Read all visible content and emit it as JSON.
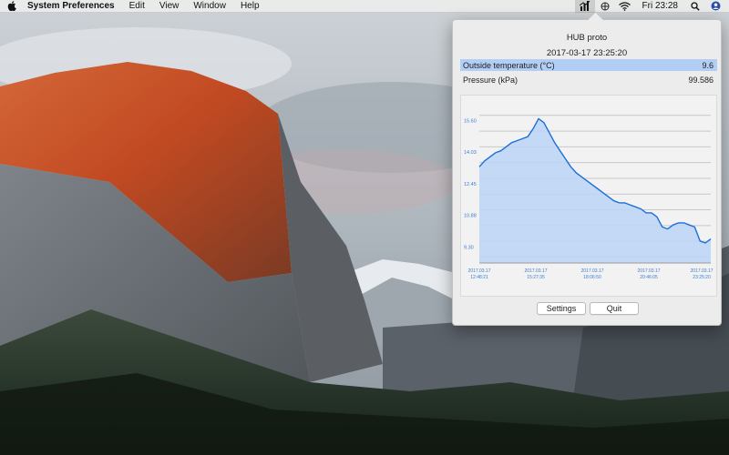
{
  "menubar": {
    "apple_icon": "apple-icon",
    "app_name": "System Preferences",
    "menus": [
      "Edit",
      "View",
      "Window",
      "Help"
    ],
    "clock": "Fri 23:28",
    "status_icons": [
      "hub-chart-icon",
      "grid-icon",
      "wifi-icon",
      "search-icon",
      "user-avatar-icon"
    ]
  },
  "popover": {
    "title": "HUB proto",
    "timestamp": "2017-03-17 23:25:20",
    "rows": [
      {
        "label": "Outside temperature (°C)",
        "value": "9.6"
      },
      {
        "label": "Pressure (kPa)",
        "value": "99.586"
      }
    ],
    "buttons": {
      "settings": "Settings",
      "quit": "Quit"
    }
  },
  "colors": {
    "highlight": "#b3cef5",
    "line": "#1a6fd9",
    "fill": "#bcd5f7",
    "grid": "#c8c8c8"
  },
  "chart_data": {
    "type": "area",
    "title": "",
    "xlabel": "",
    "ylabel": "",
    "ytick_labels": [
      "15.60",
      "14.03",
      "12.45",
      "10.88",
      "9.30"
    ],
    "yticks": [
      15.6,
      14.03,
      12.45,
      10.88,
      9.3
    ],
    "ylim": [
      8.5,
      16.4
    ],
    "xtick_labels": [
      [
        "2017.03.17",
        "12:48:21"
      ],
      [
        "2017.03.17",
        "15:27:35"
      ],
      [
        "2017.03.17",
        "18:06:50"
      ],
      [
        "2017.03.17",
        "20:46:05"
      ],
      [
        "2017.03.17",
        "23:25:20"
      ]
    ],
    "grid": true,
    "series": [
      {
        "x": [
          "12:48",
          "13:00",
          "13:15",
          "13:30",
          "13:45",
          "14:00",
          "14:15",
          "14:30",
          "14:45",
          "15:00",
          "15:15",
          "15:30",
          "15:45",
          "16:00",
          "16:15",
          "16:30",
          "16:45",
          "17:00",
          "17:15",
          "17:30",
          "17:45",
          "18:00",
          "18:15",
          "18:30",
          "18:45",
          "19:00",
          "19:15",
          "19:30",
          "19:45",
          "20:00",
          "20:15",
          "20:30",
          "20:45",
          "21:00",
          "21:15",
          "21:30",
          "21:45",
          "22:00",
          "22:15",
          "22:30",
          "22:45",
          "23:00",
          "23:15",
          "23:25"
        ],
        "values": [
          13.3,
          13.6,
          13.8,
          14.0,
          14.1,
          14.3,
          14.5,
          14.6,
          14.7,
          14.8,
          15.2,
          15.7,
          15.5,
          15.0,
          14.5,
          14.1,
          13.7,
          13.3,
          13.0,
          12.8,
          12.6,
          12.4,
          12.2,
          12.0,
          11.8,
          11.6,
          11.5,
          11.5,
          11.4,
          11.3,
          11.2,
          11.0,
          11.0,
          10.8,
          10.3,
          10.2,
          10.4,
          10.5,
          10.5,
          10.4,
          10.3,
          9.6,
          9.5,
          9.7
        ]
      }
    ]
  }
}
